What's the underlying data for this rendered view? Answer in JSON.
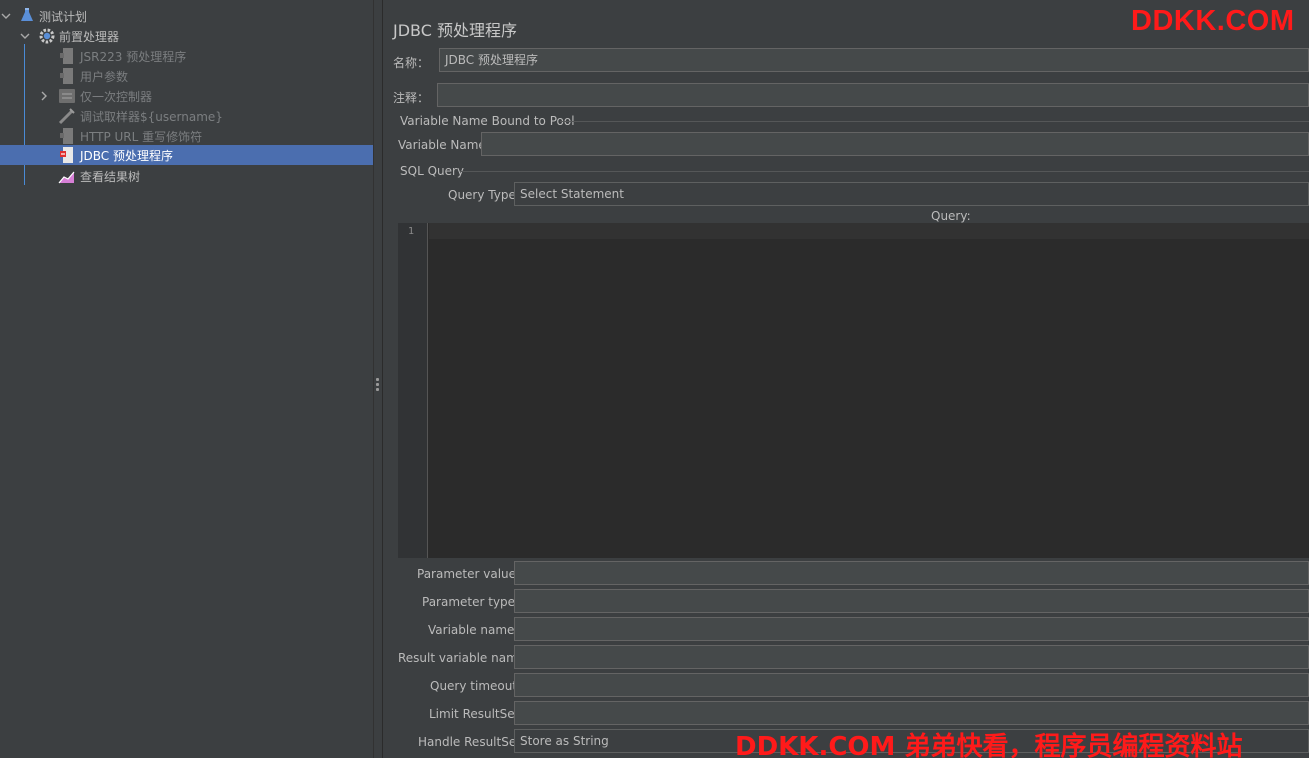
{
  "tree": {
    "items": [
      {
        "label": "测试计划",
        "disabled": false
      },
      {
        "label": "前置处理器",
        "disabled": false
      },
      {
        "label": "JSR223 预处理程序",
        "disabled": true
      },
      {
        "label": "用户参数",
        "disabled": true
      },
      {
        "label": "仅一次控制器",
        "disabled": true
      },
      {
        "label": "调试取样器${username}",
        "disabled": true
      },
      {
        "label": "HTTP URL 重写修饰符",
        "disabled": true
      },
      {
        "label": "JDBC 预处理程序",
        "disabled": false
      },
      {
        "label": "查看结果树",
        "disabled": false
      }
    ]
  },
  "panel": {
    "title": "JDBC 预处理程序",
    "name_label": "名称：",
    "name_value": "JDBC 预处理程序",
    "comment_label": "注释：",
    "comment_value": ""
  },
  "pool": {
    "group_title": "Variable Name Bound to Pool",
    "variable_name_label": "Variable Name:",
    "variable_name_value": ""
  },
  "sql": {
    "group_title": "SQL Query",
    "query_type_label": "Query Type:",
    "query_type_value": "Select Statement",
    "query_label": "Query:",
    "line_number": "1"
  },
  "params": {
    "parameter_values_label": "Parameter values:",
    "parameter_types_label": "Parameter types:",
    "variable_names_label": "Variable names:",
    "result_variable_name_label": "Result variable name:",
    "query_timeout_label": "Query timeout:",
    "limit_resultset_label": "Limit ResultSet:",
    "handle_resultset_label": "Handle ResultSet:",
    "handle_resultset_value": "Store as String"
  },
  "watermark": {
    "top": "DDKK.COM",
    "bottom": "DDKK.COM 弟弟快看，程序员编程资料站"
  },
  "colors": {
    "selection": "#4b6eaf",
    "watermark": "#ff1a1a"
  }
}
